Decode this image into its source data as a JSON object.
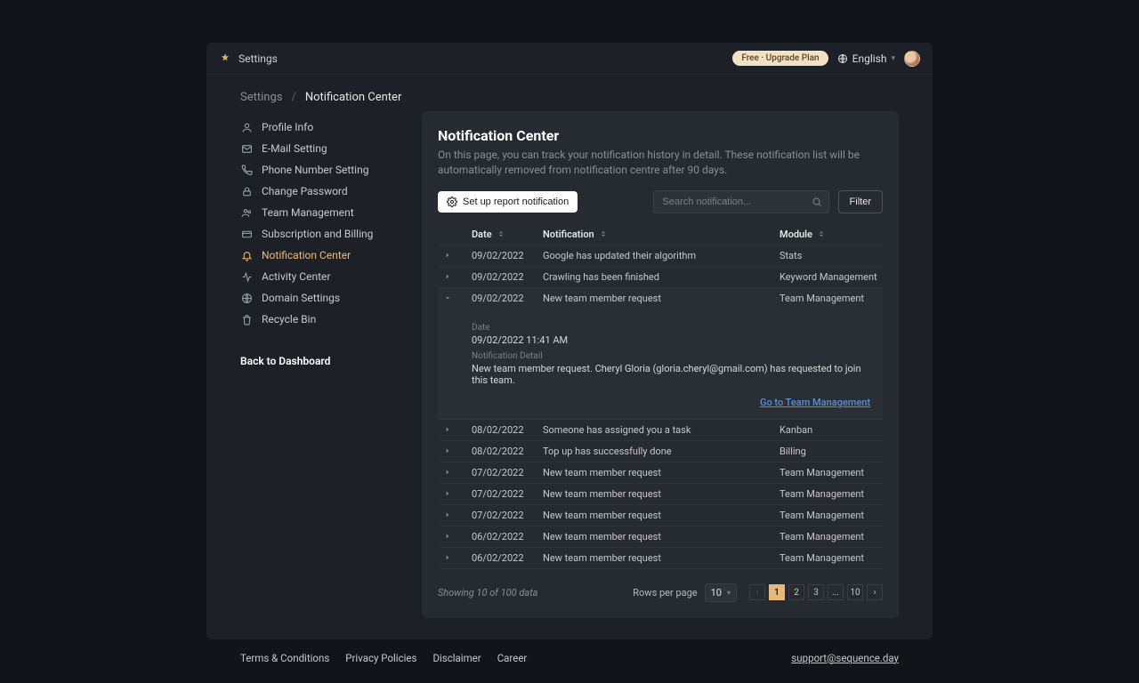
{
  "header": {
    "brand_label": "Settings",
    "upgrade_pill": "Free · Upgrade Plan",
    "language": "English"
  },
  "breadcrumb": {
    "parent": "Settings",
    "separator": "/",
    "current": "Notification Center"
  },
  "sidebar": {
    "items": [
      {
        "label": "Profile Info",
        "icon": "user-icon"
      },
      {
        "label": "E-Mail Setting",
        "icon": "mail-icon"
      },
      {
        "label": "Phone Number Setting",
        "icon": "phone-icon"
      },
      {
        "label": "Change Password",
        "icon": "lock-icon"
      },
      {
        "label": "Team Management",
        "icon": "team-icon"
      },
      {
        "label": "Subscription and Billing",
        "icon": "card-icon"
      },
      {
        "label": "Notification Center",
        "icon": "bell-icon",
        "active": true
      },
      {
        "label": "Activity Center",
        "icon": "activity-icon"
      },
      {
        "label": "Domain Settings",
        "icon": "globe-icon"
      },
      {
        "label": "Recycle Bin",
        "icon": "trash-icon"
      }
    ],
    "back_label": "Back to Dashboard"
  },
  "panel": {
    "title": "Notification Center",
    "subtitle": "On this page, you can track your notification history in detail. These notification list will be automatically removed from notification centre after 90 days.",
    "setup_btn": "Set up report notification",
    "search_placeholder": "Search notification...",
    "filter_btn": "Filter",
    "columns": {
      "date": "Date",
      "notification": "Notification",
      "module": "Module"
    },
    "rows": [
      {
        "date": "09/02/2022",
        "msg": "Google has updated their algorithm",
        "module": "Stats"
      },
      {
        "date": "09/02/2022",
        "msg": "Crawling has been finished",
        "module": "Keyword Management"
      },
      {
        "date": "09/02/2022",
        "msg": "New team member request",
        "module": "Team Management",
        "expanded": true
      },
      {
        "date": "08/02/2022",
        "msg": "Someone has assigned you a task",
        "module": "Kanban"
      },
      {
        "date": "08/02/2022",
        "msg": "Top up has successfully done",
        "module": "Billing"
      },
      {
        "date": "07/02/2022",
        "msg": "New team member request",
        "module": "Team Management"
      },
      {
        "date": "07/02/2022",
        "msg": "New team member request",
        "module": "Team Management"
      },
      {
        "date": "07/02/2022",
        "msg": "New team member request",
        "module": "Team Management"
      },
      {
        "date": "06/02/2022",
        "msg": "New team member request",
        "module": "Team Management"
      },
      {
        "date": "06/02/2022",
        "msg": "New team member request",
        "module": "Team Management"
      }
    ],
    "detail": {
      "date_label": "Date",
      "date_value": "09/02/2022 11:41 AM",
      "detail_label": "Notification Detail",
      "detail_value": "New team member request. Cheryl Gloria (gloria.cheryl@gmail.com) has requested to join this team.",
      "go_link": "Go to Team Management"
    },
    "showing": "Showing 10 of 100 data",
    "rows_per_page_label": "Rows per page",
    "rows_per_page_value": "10",
    "pager": {
      "pages": [
        "1",
        "2",
        "3",
        "...",
        "10"
      ]
    }
  },
  "footer": {
    "links": [
      "Terms & Conditions",
      "Privacy Policies",
      "Disclaimer",
      "Career"
    ],
    "support": "support@sequence.day"
  }
}
